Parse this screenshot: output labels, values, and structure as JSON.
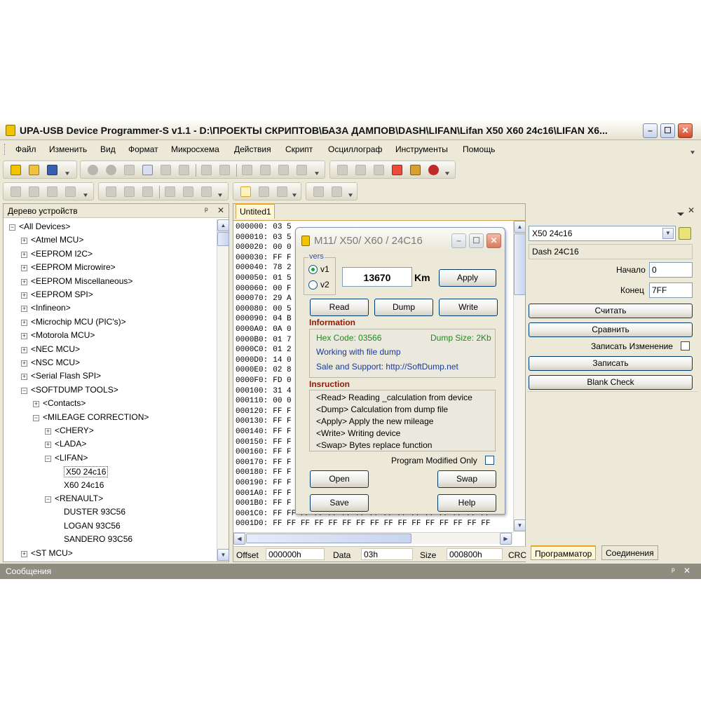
{
  "window": {
    "title": "UPA-USB Device Programmer-S v1.1 - D:\\ПРОЕКТЫ СКРИПТОВ\\БАЗА ДАМПОВ\\DASH\\LIFAN\\Lifan X50 X60 24c16\\LIFAN X6...",
    "minimize": "–",
    "maximize": "☐",
    "close": "✕"
  },
  "menu": [
    "Файл",
    "Изменить",
    "Вид",
    "Формат",
    "Микросхема",
    "Действия",
    "Скрипт",
    "Осциллограф",
    "Инструменты",
    "Помощь"
  ],
  "left_panel": {
    "title": "Дерево устройств",
    "pin": "ᵖ",
    "close": "✕",
    "tree": [
      {
        "label": "<All Devices>",
        "level": 0,
        "expander": "−"
      },
      {
        "label": "<Atmel MCU>",
        "level": 1,
        "expander": "+"
      },
      {
        "label": "<EEPROM I2C>",
        "level": 1,
        "expander": "+"
      },
      {
        "label": "<EEPROM Microwire>",
        "level": 1,
        "expander": "+"
      },
      {
        "label": "<EEPROM Miscellaneous>",
        "level": 1,
        "expander": "+"
      },
      {
        "label": "<EEPROM SPI>",
        "level": 1,
        "expander": "+"
      },
      {
        "label": "<Infineon>",
        "level": 1,
        "expander": "+"
      },
      {
        "label": "<Microchip MCU (PIC's)>",
        "level": 1,
        "expander": "+"
      },
      {
        "label": "<Motorola MCU>",
        "level": 1,
        "expander": "+"
      },
      {
        "label": "<NEC MCU>",
        "level": 1,
        "expander": "+"
      },
      {
        "label": "<NSC MCU>",
        "level": 1,
        "expander": "+"
      },
      {
        "label": "<Serial Flash SPI>",
        "level": 1,
        "expander": "+"
      },
      {
        "label": "<SOFTDUMP TOOLS>",
        "level": 1,
        "expander": "−"
      },
      {
        "label": "<Contacts>",
        "level": 2,
        "expander": "+"
      },
      {
        "label": "<MILEAGE CORRECTION>",
        "level": 2,
        "expander": "−"
      },
      {
        "label": "<CHERY>",
        "level": 3,
        "expander": "+"
      },
      {
        "label": "<LADA>",
        "level": 3,
        "expander": "+"
      },
      {
        "label": "<LIFAN>",
        "level": 3,
        "expander": "−"
      },
      {
        "label": "X50 24c16",
        "level": 4,
        "expander": "",
        "selected": true
      },
      {
        "label": "X60 24c16",
        "level": 4,
        "expander": ""
      },
      {
        "label": "<RENAULT>",
        "level": 3,
        "expander": "−"
      },
      {
        "label": "DUSTER 93C56",
        "level": 4,
        "expander": ""
      },
      {
        "label": "LOGAN 93C56",
        "level": 4,
        "expander": ""
      },
      {
        "label": "SANDERO 93C56",
        "level": 4,
        "expander": ""
      },
      {
        "label": "<ST MCU>",
        "level": 1,
        "expander": "+"
      }
    ]
  },
  "doc_tab": "Untited1",
  "hex": {
    "offsets": [
      "000000:",
      "000010:",
      "000020:",
      "000030:",
      "000040:",
      "000050:",
      "000060:",
      "000070:",
      "000080:",
      "000090:",
      "0000A0:",
      "0000B0:",
      "0000C0:",
      "0000D0:",
      "0000E0:",
      "0000F0:",
      "000100:",
      "000110:",
      "000120:",
      "000130:",
      "000140:",
      "000150:",
      "000160:",
      "000170:",
      "000180:",
      "000190:",
      "0001A0:",
      "0001B0:",
      "0001C0:",
      "0001D0:"
    ],
    "first_bytes": [
      "03 5",
      "03 5",
      "00 0",
      "FF F",
      "78 2",
      "01 5",
      "00 F",
      "29 A",
      "00 5",
      "04 B",
      "0A 0",
      "01 7",
      "01 2",
      "14 0",
      "02 8",
      "FD 0",
      "31 4",
      "00 0",
      "FF F",
      "FF F",
      "FF F",
      "FF F",
      "FF F",
      "FF F",
      "FF F",
      "FF F",
      "FF F",
      "FF F",
      "FF FF FF FF FF FF FF FF FF FF FF FF FF FF FF FF",
      "FF FF FF FF FF FF FF FF FF FF FF FF FF FF FF FF"
    ]
  },
  "status": {
    "offset_label": "Offset",
    "offset_value": "000000h",
    "data_label": "Data",
    "data_value": "03h",
    "size_label": "Size",
    "size_value": "000800h",
    "crc_label": "CRC"
  },
  "right_panel": {
    "device_select": "X50 24c16",
    "device_desc": "Dash 24C16",
    "start_label": "Начало",
    "start_value": "0",
    "end_label": "Конец",
    "end_value": "7FF",
    "read_btn": "Считать",
    "compare_btn": "Сравнить",
    "write_changes_label": "Записать Изменение",
    "write_btn": "Записать",
    "blank_check_btn": "Blank Check",
    "tabs": [
      "Программатор",
      "Соединения"
    ]
  },
  "messages_bar": {
    "title": "Сообщения",
    "pin": "ᵖ",
    "close": "✕"
  },
  "dialog": {
    "title": "M11/ X50/ X60 / 24C16",
    "vers_label": "vers",
    "v1_label": "v1",
    "v2_label": "v2",
    "mileage_value": "13670",
    "unit": "Km",
    "apply_btn": "Apply",
    "read_btn": "Read",
    "dump_btn": "Dump",
    "write_btn": "Write",
    "info_title": "Information",
    "hex_code": "Hex Code: 03566",
    "dump_size": "Dump Size: 2Kb",
    "working_with": "Working with file dump",
    "sale_support": "Sale and Support:  http://SoftDump.net",
    "instr_title": "Insruction",
    "instructions": [
      "<Read>  Reading _calculation from device",
      "<Dump>  Calculation from dump file",
      "<Apply>  Apply the new mileage",
      "<Write>  Writing device",
      "<Swap>  Bytes replace function"
    ],
    "program_modified_only": "Program Modified Only",
    "open_btn": "Open",
    "swap_btn": "Swap",
    "save_btn": "Save",
    "help_btn": "Help"
  },
  "colors": {
    "app_bg": "#ece9d8",
    "section_title": "#8b1a0b",
    "info_green": "#1f8a1f",
    "info_blue": "#1a3a9a"
  }
}
